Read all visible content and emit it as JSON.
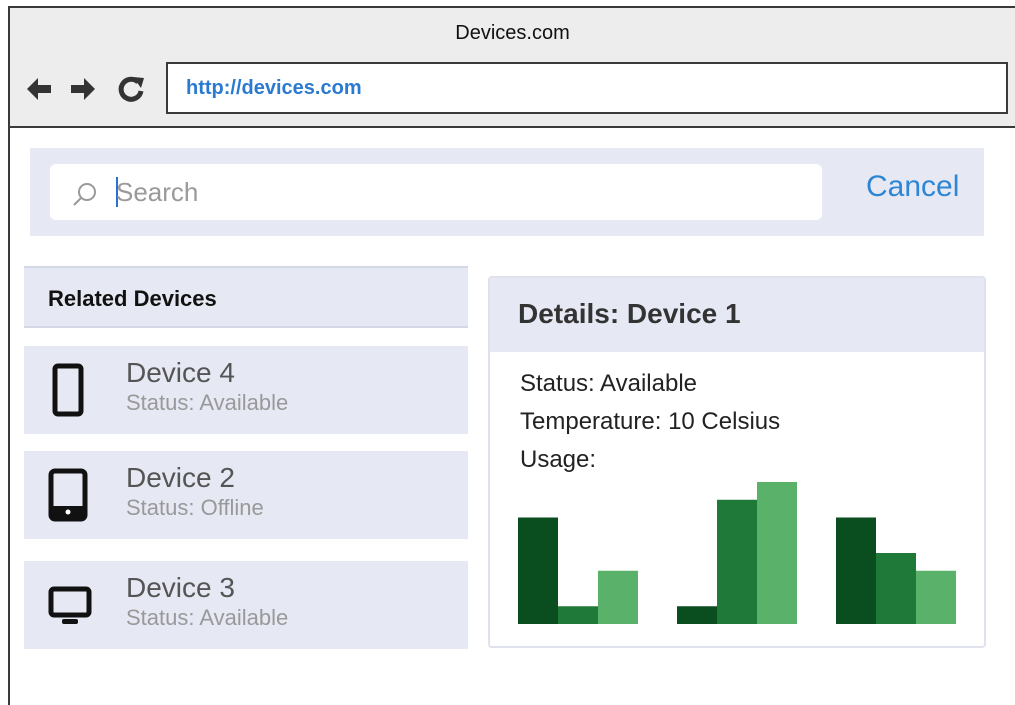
{
  "browser": {
    "title": "Devices.com",
    "url": "http://devices.com",
    "nav_icons": [
      "arrow-left-icon",
      "arrow-right-icon",
      "reload-icon"
    ]
  },
  "search": {
    "placeholder": "Search",
    "value": "",
    "cancel_label": "Cancel",
    "icon": "search-icon"
  },
  "related": {
    "title": "Related Devices",
    "items": [
      {
        "name": "Device 4",
        "status": "Status: Available",
        "icon": "phone-icon"
      },
      {
        "name": "Device 2",
        "status": "Status: Offline",
        "icon": "tablet-icon"
      },
      {
        "name": "Device 3",
        "status": "Status: Available",
        "icon": "monitor-icon"
      }
    ]
  },
  "details": {
    "title": "Details: Device 1",
    "status": "Status: Available",
    "temperature": "Temperature: 10 Celsius",
    "usage_label": "Usage:"
  },
  "colors": {
    "panel_bg": "#e6e9f4",
    "link_blue": "#2d86d4",
    "url_blue": "#2a7ad1",
    "series_dark": "#0a4d1f",
    "series_mid": "#1f7a3a",
    "series_light": "#5ab26a"
  },
  "chart_data": {
    "type": "bar",
    "categories": [
      "",
      "",
      ""
    ],
    "series": [
      {
        "values": [
          6,
          1,
          6
        ]
      },
      {
        "values": [
          1,
          7,
          4
        ]
      },
      {
        "values": [
          3,
          8,
          3
        ]
      }
    ],
    "title": "",
    "xlabel": "",
    "ylabel": "",
    "ylim": [
      0,
      8
    ],
    "grid": false
  }
}
